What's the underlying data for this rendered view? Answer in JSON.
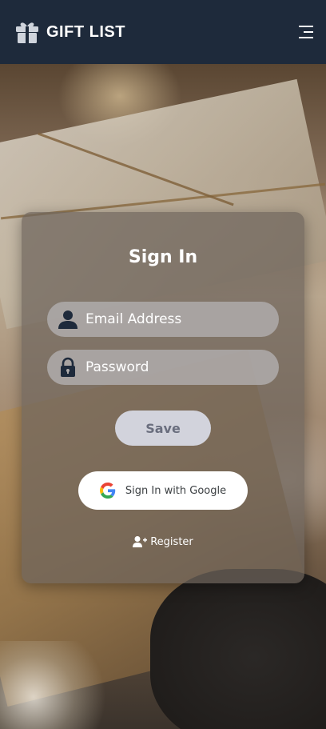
{
  "header": {
    "title": "GIFT LIST",
    "brand_icon": "gift-icon",
    "menu_icon": "hamburger-menu-icon",
    "background_color": "#1e2a3b"
  },
  "signin": {
    "title": "Sign In",
    "email": {
      "placeholder": "Email Address",
      "value": "",
      "icon": "user-icon"
    },
    "password": {
      "placeholder": "Password",
      "value": "",
      "icon": "lock-icon"
    },
    "save_label": "Save",
    "google_label": "Sign In with Google",
    "google_icon": "google-g-icon",
    "register_label": "Register",
    "register_icon": "user-plus-icon"
  }
}
